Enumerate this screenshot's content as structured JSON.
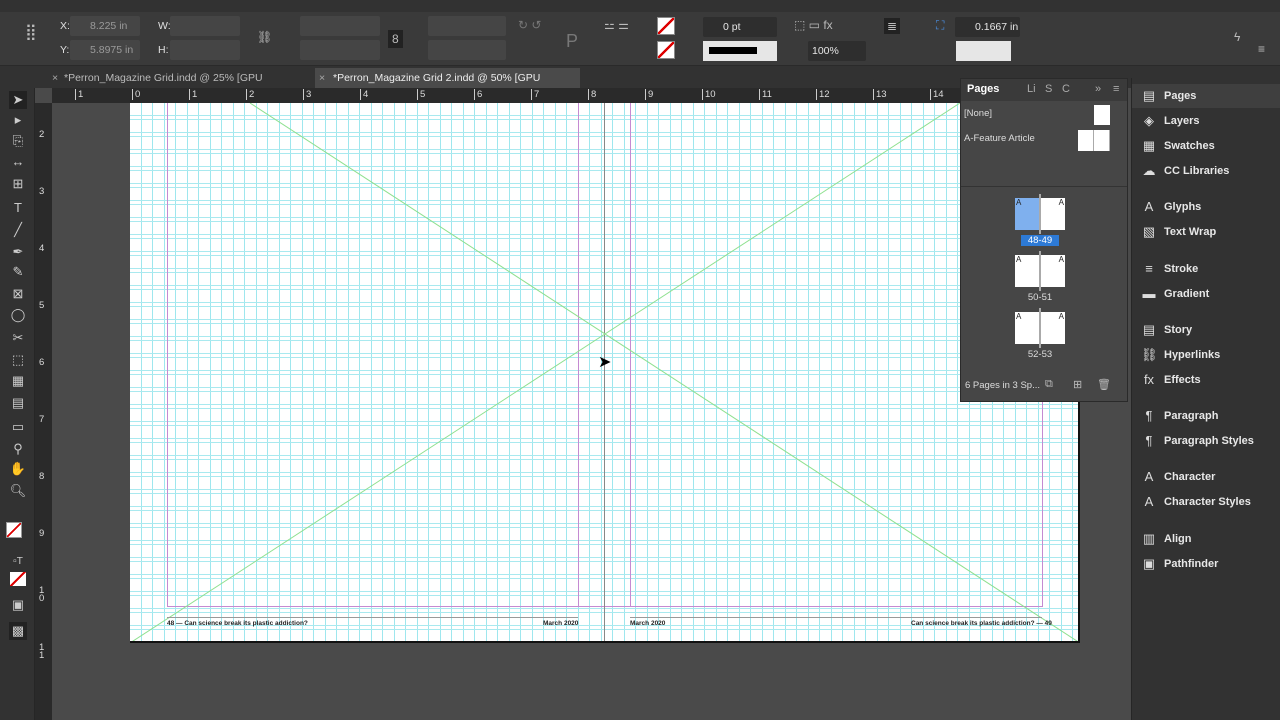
{
  "control": {
    "x_label": "X:",
    "x_value": "8.225 in",
    "y_label": "Y:",
    "y_value": "5.8975 in",
    "w_label": "W:",
    "h_label": "H:",
    "stroke_weight": "0 pt",
    "opacity": "100%",
    "offset": "0.1667 in"
  },
  "tabs": [
    {
      "label": "*Perron_Magazine Grid.indd @ 25% [GPU Preview]"
    },
    {
      "label": "*Perron_Magazine Grid 2.indd @ 50% [GPU Preview]"
    }
  ],
  "hruler": [
    "1",
    "0",
    "1",
    "2",
    "3",
    "4",
    "5",
    "6",
    "7",
    "8",
    "9",
    "10",
    "11",
    "12",
    "13",
    "14"
  ],
  "vruler": [
    "2",
    "3",
    "4",
    "5",
    "6",
    "7",
    "8",
    "9",
    "10",
    "11"
  ],
  "page": {
    "footer_left": "48 — Can science break its plastic addiction?",
    "date_left": "March 2020",
    "date_right": "March 2020",
    "footer_right": "Can science break its plastic addiction? — 49"
  },
  "pages_panel": {
    "tabs": [
      "Pages",
      "Li",
      "S",
      "C"
    ],
    "masters": [
      "[None]",
      "A-Feature Article"
    ],
    "spreads": [
      "48-49",
      "50-51",
      "52-53"
    ],
    "master_letter": "A",
    "status": "6 Pages in 3 Sp..."
  },
  "dock": [
    "Pages",
    "Layers",
    "Swatches",
    "CC Libraries",
    "Glyphs",
    "Text Wrap",
    "Stroke",
    "Gradient",
    "Story",
    "Hyperlinks",
    "Effects",
    "Paragraph",
    "Paragraph Styles",
    "Character",
    "Character Styles",
    "Align",
    "Pathfinder"
  ],
  "colors": {
    "accent": "#2d7ad6",
    "guide": "#9ee7ee",
    "margin": "#c58ad2",
    "diagonal": "#8fe08f"
  }
}
